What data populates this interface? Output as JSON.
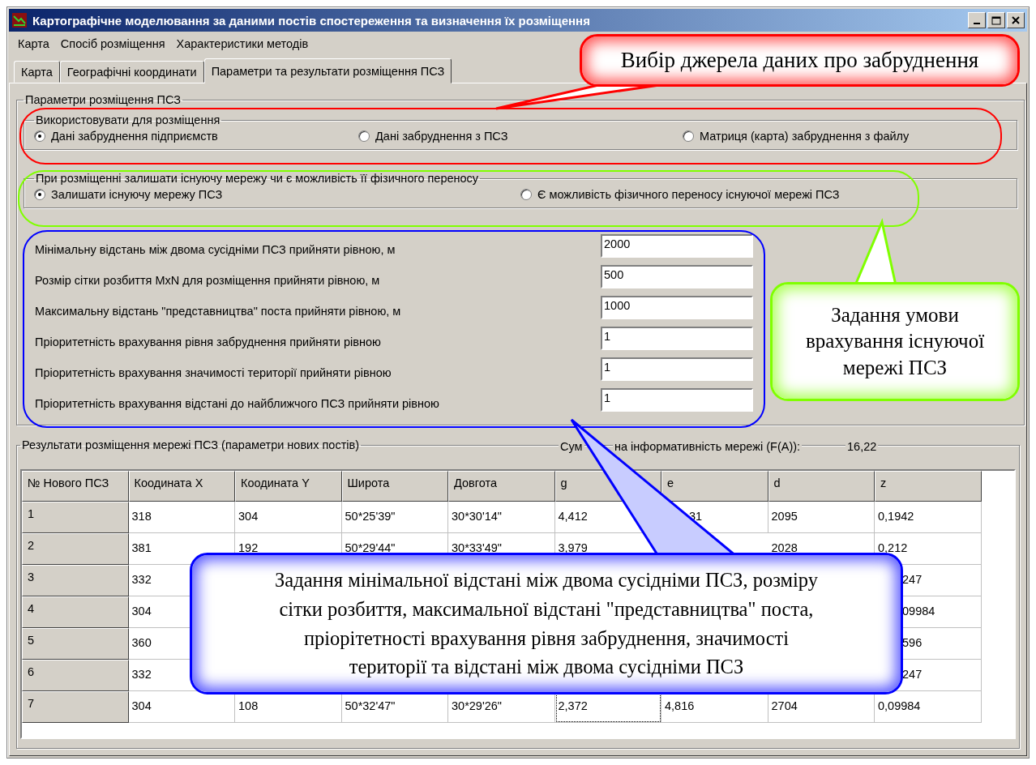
{
  "window": {
    "title": "Картографічне моделювання за даними постів спостереження та визначення їх розміщення"
  },
  "menu": [
    "Карта",
    "Спосіб розміщення",
    "Характеристики методів"
  ],
  "tabs": [
    {
      "label": "Карта",
      "selected": false
    },
    {
      "label": "Географічні координати",
      "selected": false
    },
    {
      "label": "Параметри та результати розміщення ПСЗ",
      "selected": true
    }
  ],
  "placement_group": {
    "title": "Параметри розміщення ПСЗ",
    "source_group": {
      "title": "Використовувати для розміщення",
      "options": [
        {
          "label": "Дані забруднення підприємств",
          "selected": true
        },
        {
          "label": "Дані забруднення з ПСЗ",
          "selected": false
        },
        {
          "label": "Матриця (карта) забруднення з файлу",
          "selected": false
        }
      ]
    },
    "network_group": {
      "title": "При розміщенні залишати існуючу мережу чи є можливість її фізичного переносу",
      "options": [
        {
          "label": "Залишати існуючу мережу ПСЗ",
          "selected": true
        },
        {
          "label": "Є можливість фізичного переносу існуючої мережі ПСЗ",
          "selected": false
        }
      ]
    },
    "parameters": [
      {
        "label": "Мінімальну відстань між двома сусідніми ПСЗ прийняти рівною, м",
        "value": "2000"
      },
      {
        "label": "Розмір сітки розбиття MxN для розміщення прийняти рівною, м",
        "value": "500"
      },
      {
        "label": "Максимальну відстань \"представництва\" поста прийняти рівною, м",
        "value": "1000"
      },
      {
        "label": "Пріоритетність врахування рівня забруднення прийняти рівною",
        "value": "1"
      },
      {
        "label": "Пріоритетність врахування значимості території прийняти рівною",
        "value": "1"
      },
      {
        "label": "Пріоритетність врахування відстані до найближчого ПСЗ прийняти рівною",
        "value": "1"
      }
    ]
  },
  "results_group": {
    "title": "Результати розміщення мережі ПСЗ (параметри нових постів)",
    "summary_label_start": "Сум",
    "summary_label_end": "на інформативність мережі (F(A)):",
    "summary_value": "16,22",
    "table": {
      "columns": [
        "№ Нового ПСЗ",
        "Коодината X",
        "Коодината Y",
        "Широта",
        "Довгота",
        "g",
        "e",
        "d",
        "z"
      ],
      "rows": [
        {
          "cells": [
            "1",
            "318",
            "304",
            "50*25'39\"",
            "30*30'14\"",
            "4,412",
            {
              "text": "31",
              "kind": "partial"
            },
            "2095",
            "0,1942"
          ]
        },
        {
          "cells": [
            "2",
            "381",
            "192",
            "50*29'44\"",
            "30*33'49\"",
            "3,979",
            null,
            "2028",
            "0,212"
          ]
        },
        {
          "cells": [
            "3",
            "332",
            null,
            null,
            null,
            null,
            null,
            null,
            {
              "text": "247",
              "kind": "partial"
            }
          ]
        },
        {
          "cells": [
            "4",
            "304",
            null,
            null,
            null,
            null,
            null,
            null,
            {
              "text": "09984",
              "kind": "partial"
            }
          ]
        },
        {
          "cells": [
            "5",
            "360",
            null,
            null,
            null,
            null,
            null,
            null,
            {
              "text": "596",
              "kind": "partial"
            }
          ]
        },
        {
          "cells": [
            "6",
            "332",
            null,
            null,
            null,
            null,
            null,
            null,
            {
              "text": "247",
              "kind": "partial"
            }
          ]
        },
        {
          "cells": [
            "7",
            "304",
            "108",
            "50*32'47\"",
            "30*29'26\"",
            {
              "text": "2,372",
              "kind": "focused"
            },
            "4,816",
            "2704",
            "0,09984"
          ]
        }
      ]
    }
  },
  "callouts": [
    {
      "text": "Вибір джерела даних про забруднення",
      "color": "#ff0000"
    },
    {
      "text": "Задання умови\nврахування існуючої\nмережі ПСЗ",
      "color": "#80ff00"
    },
    {
      "text": "Задання мінімальної відстані між двома сусідніми ПСЗ, розміру\nсітки розбиття, максимальної відстані \"представництва\" поста,\nпріорітетності врахування рівня забруднення, значимості\nтериторії та відстані між двома сусідніми ПСЗ",
      "color": "#0000ff"
    }
  ]
}
